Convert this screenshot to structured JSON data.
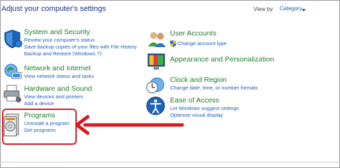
{
  "header": {
    "title": "Adjust your computer's settings",
    "view_by_label": "View by:",
    "view_by_value": "Category"
  },
  "categories_left": [
    {
      "title": "System and Security",
      "links": [
        "Review your computer's status",
        "Save backup copies of your files with File History",
        "Backup and Restore (Windows 7)"
      ]
    },
    {
      "title": "Network and Internet",
      "links": [
        "View network status and tasks"
      ]
    },
    {
      "title": "Hardware and Sound",
      "links": [
        "View devices and printers",
        "Add a device"
      ]
    },
    {
      "title": "Programs",
      "links": [
        "Uninstall a program",
        "Get programs"
      ]
    }
  ],
  "categories_right": [
    {
      "title": "User Accounts",
      "links": [
        "Change account type"
      ]
    },
    {
      "title": "Appearance and Personalization",
      "links": []
    },
    {
      "title": "Clock and Region",
      "links": [
        "Change date, time, or number formats"
      ]
    },
    {
      "title": "Ease of Access",
      "links": [
        "Let Windows suggest settings",
        "Optimize visual display"
      ]
    }
  ],
  "colors": {
    "heading": "#1f7a2f",
    "link": "#1f5fb5",
    "annotation": "#d71920"
  },
  "icons": [
    "shield-icon",
    "globe-network-icon",
    "printer-icon",
    "programs-disk-icon",
    "user-accounts-icon",
    "uac-shield-icon",
    "appearance-icon",
    "clock-globe-icon",
    "ease-of-access-icon",
    "annotation-arrow"
  ]
}
